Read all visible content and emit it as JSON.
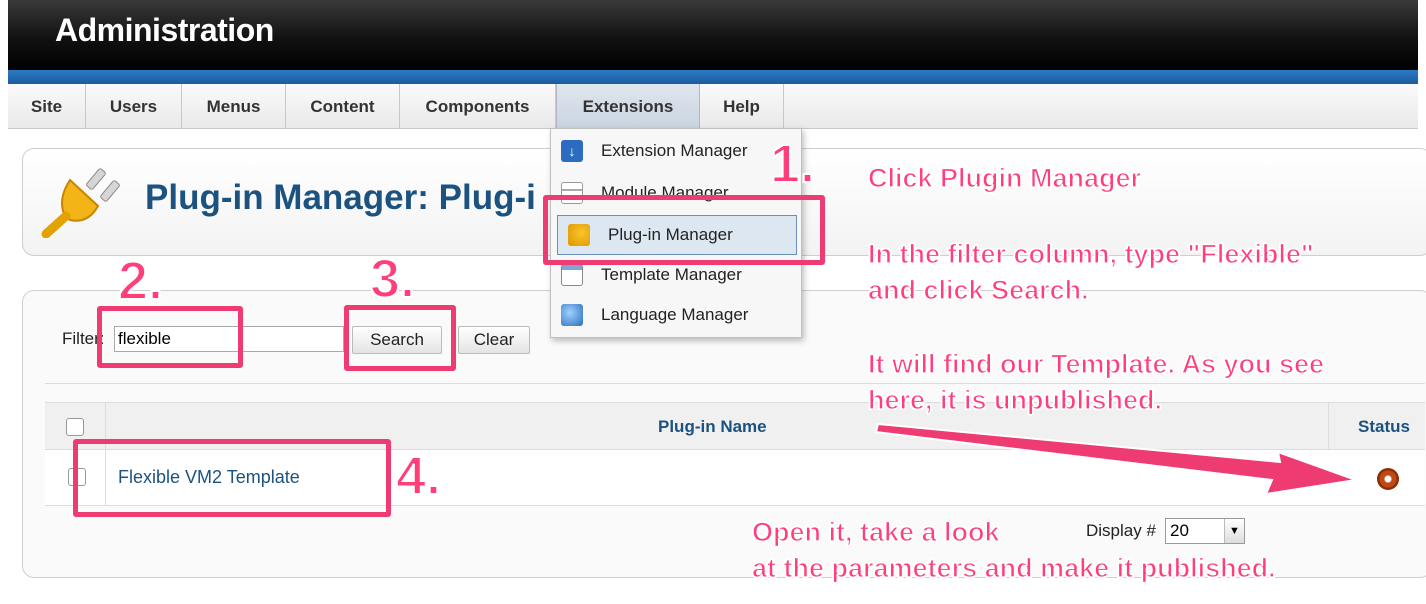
{
  "header": {
    "title": "Administration"
  },
  "menu": {
    "items": [
      "Site",
      "Users",
      "Menus",
      "Content",
      "Components",
      "Extensions",
      "Help"
    ],
    "active": "Extensions"
  },
  "dropdown": {
    "items": [
      {
        "label": "Extension Manager",
        "icon": "extension-manager-icon"
      },
      {
        "label": "Module Manager",
        "icon": "module-manager-icon"
      },
      {
        "label": "Plug-in Manager",
        "icon": "plugin-manager-icon"
      },
      {
        "label": "Template Manager",
        "icon": "template-manager-icon"
      },
      {
        "label": "Language Manager",
        "icon": "language-manager-icon"
      }
    ],
    "selected": "Plug-in Manager"
  },
  "page": {
    "title": "Plug-in Manager: Plug-i"
  },
  "filter": {
    "label": "Filter:",
    "value": "flexible",
    "search_label": "Search",
    "clear_label": "Clear"
  },
  "table": {
    "columns": [
      "Plug-in Name",
      "Status"
    ],
    "rows": [
      {
        "name": "Flexible VM2 Template",
        "status": "unpublished"
      }
    ]
  },
  "pagination": {
    "display_label": "Display #",
    "display_value": "20"
  },
  "annotations": {
    "step1": "1.",
    "step2": "2.",
    "step3": "3.",
    "step4": "4.",
    "note1": "Click Plugin Manager",
    "note2_line1": "In the filter column, type \"Flexible\"",
    "note2_line2": "and click Search.",
    "note3_line1": "It will find our Template. As you see",
    "note3_line2": "here, it is unpublished.",
    "note4_line1": "Open it, take a look",
    "note4_line2": "at the parameters and make it published.",
    "color": "#ee3b72"
  },
  "colors": {
    "title_blue": "#1b5280",
    "header_blue": "#2c79c4",
    "status_orange": "#c24a12"
  }
}
